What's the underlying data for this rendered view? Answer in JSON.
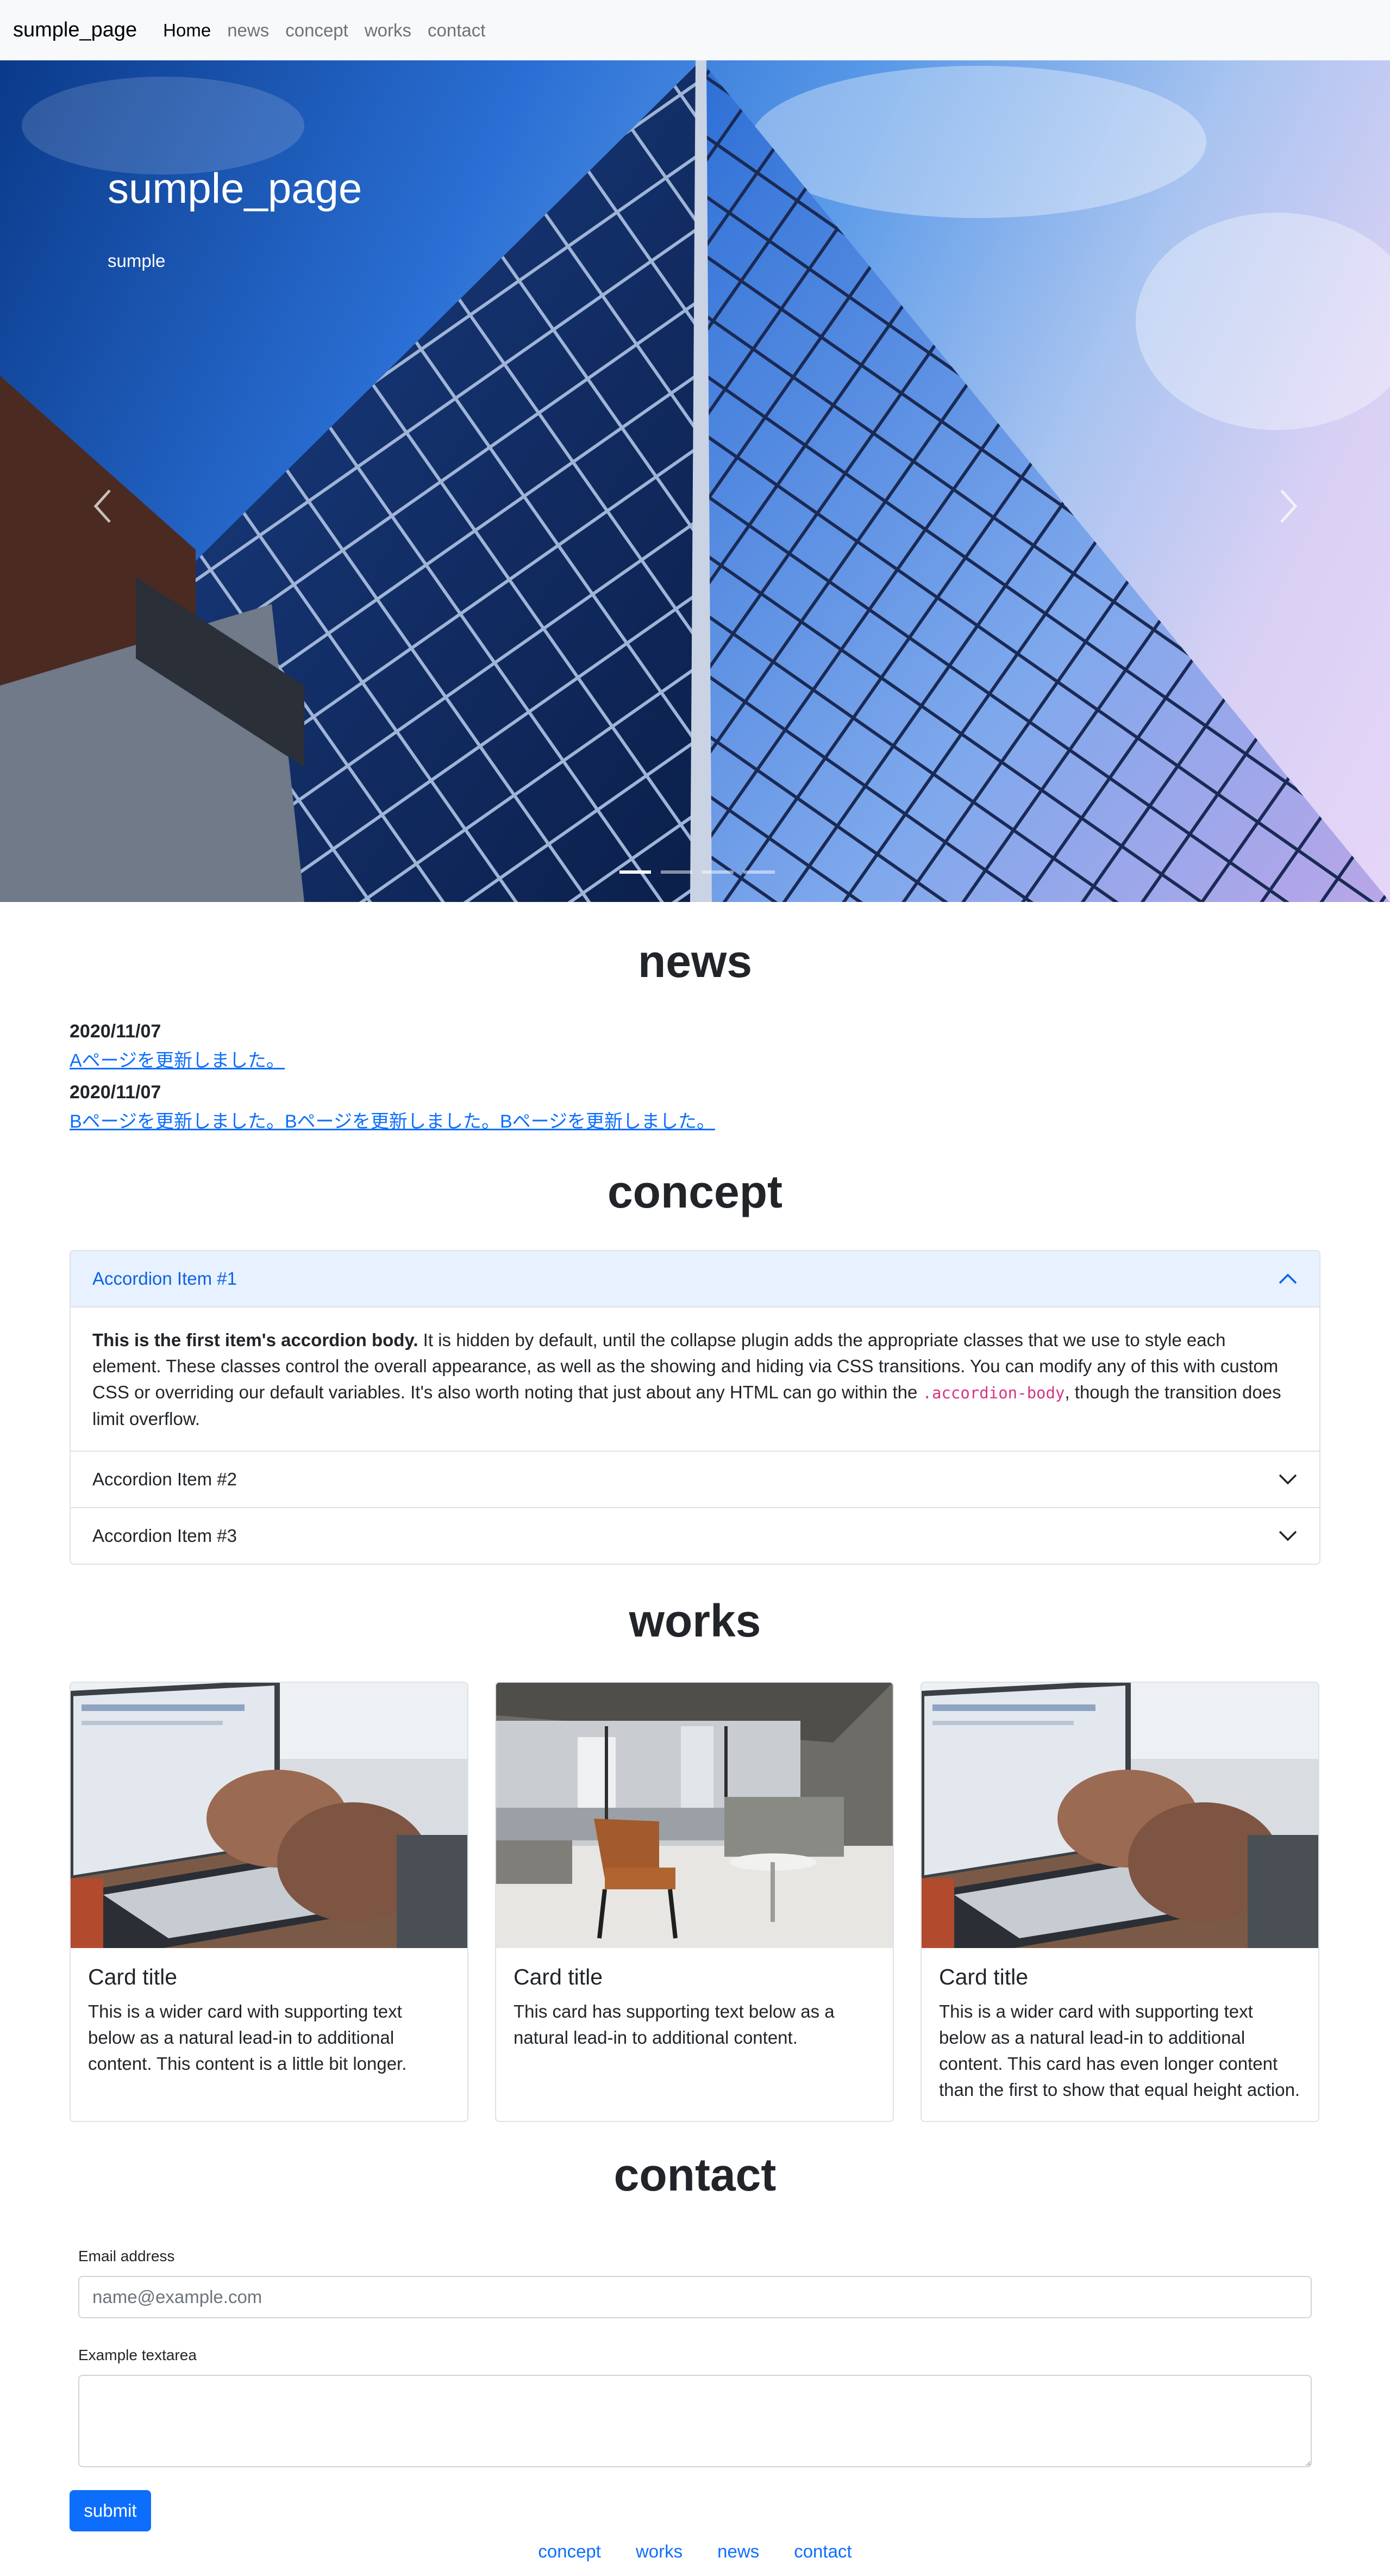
{
  "navbar": {
    "brand": "sumple_page",
    "links": [
      {
        "label": "Home",
        "active": true
      },
      {
        "label": "news",
        "active": false
      },
      {
        "label": "concept",
        "active": false
      },
      {
        "label": "works",
        "active": false
      },
      {
        "label": "contact",
        "active": false
      }
    ]
  },
  "hero": {
    "title": "sumple_page",
    "subtitle": "sumple",
    "prev_icon": "chevron-left-icon",
    "next_icon": "chevron-right-icon",
    "indicators": 4,
    "active_indicator": 0
  },
  "news": {
    "title": "news",
    "items": [
      {
        "date": "2020/11/07",
        "text": "Aページを更新しました。"
      },
      {
        "date": "2020/11/07",
        "text": "Bページを更新しました。Bページを更新しました。Bページを更新しました。"
      }
    ]
  },
  "concept": {
    "title": "concept",
    "accordion": [
      {
        "label": "Accordion Item #1",
        "open": true,
        "body_strong": "This is the first item's accordion body.",
        "body_text": " It is hidden by default, until the collapse plugin adds the appropriate classes that we use to style each element. These classes control the overall appearance, as well as the showing and hiding via CSS transitions. You can modify any of this with custom CSS or overriding our default variables. It's also worth noting that just about any HTML can go within the ",
        "body_code": ".accordion-body",
        "body_tail": ", though the transition does limit overflow."
      },
      {
        "label": "Accordion Item #2",
        "open": false
      },
      {
        "label": "Accordion Item #3",
        "open": false
      }
    ]
  },
  "works": {
    "title": "works",
    "cards": [
      {
        "title": "Card title",
        "text": "This is a wider card with supporting text below as a natural lead-in to additional content. This content is a little bit longer.",
        "image": "laptop-typing-photo"
      },
      {
        "title": "Card title",
        "text": "This card has supporting text below as a natural lead-in to additional content.",
        "image": "lounge-chair-photo"
      },
      {
        "title": "Card title",
        "text": "This is a wider card with supporting text below as a natural lead-in to additional content. This card has even longer content than the first to show that equal height action.",
        "image": "laptop-typing-photo"
      }
    ]
  },
  "contact": {
    "title": "contact",
    "email_label": "Email address",
    "email_placeholder": "name@example.com",
    "textarea_label": "Example textarea",
    "submit_label": "submit"
  },
  "footer": {
    "links": [
      "concept",
      "works",
      "news",
      "contact"
    ]
  },
  "colors": {
    "primary": "#0d6efd",
    "navbar_bg": "#f8f9fa",
    "accordion_open_bg": "#e7f1ff",
    "code": "#d63384"
  }
}
